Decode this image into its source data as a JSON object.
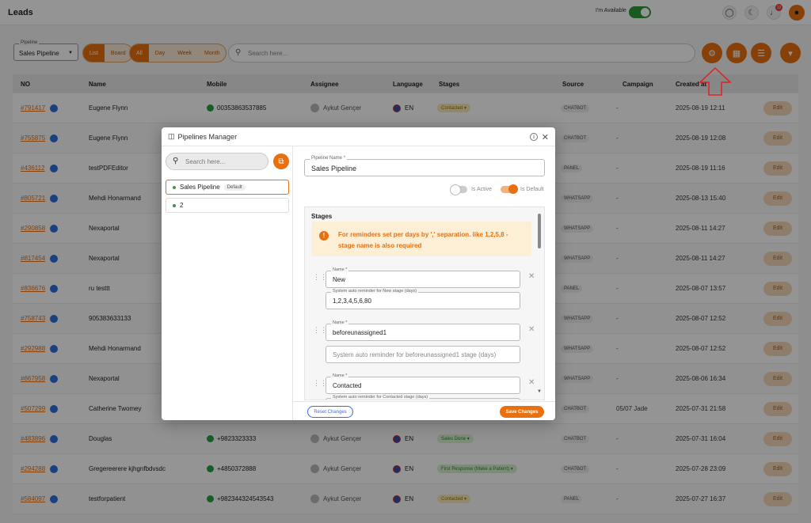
{
  "header": {
    "title": "Leads",
    "availability_label": "I'm Available",
    "notification_count": "12",
    "icons": [
      "globe-icon",
      "moon-icon",
      "bell-icon",
      "user-icon"
    ]
  },
  "filters": {
    "pipeline_label": "Pipeline",
    "pipeline_value": "Sales Pipeline",
    "view_modes": [
      "List",
      "Board"
    ],
    "active_view": "List",
    "periods": [
      "All",
      "Day",
      "Week",
      "Month"
    ],
    "active_period": "All",
    "search_placeholder": "Search here...",
    "action_icons": [
      "gear-icon",
      "board-icon",
      "list-icon",
      "funnel-icon"
    ]
  },
  "table": {
    "columns": [
      "NO",
      "Name",
      "Mobile",
      "Assignee",
      "Language",
      "Stages",
      "Source",
      "Campaign",
      "Created at"
    ],
    "edit_label": "Edit",
    "rows": [
      {
        "id": "#791417",
        "name": "Eugene Flynn",
        "mobile": "00353863537885",
        "assignee": "Aykut Gençer",
        "lang": "EN",
        "stage": "Contacted",
        "source": "CHATBOT",
        "campaign": "-",
        "created": "2025-08-19 12:11"
      },
      {
        "id": "#755875",
        "name": "Eugene Flynn",
        "mobile": "",
        "assignee": "",
        "lang": "",
        "stage": "",
        "source": "CHATBOT",
        "campaign": "-",
        "created": "2025-08-19 12:08"
      },
      {
        "id": "#436112",
        "name": "testPDFEditor",
        "mobile": "",
        "assignee": "",
        "lang": "",
        "stage": "",
        "source": "PANEL",
        "campaign": "-",
        "created": "2025-08-19 11:16"
      },
      {
        "id": "#805721",
        "name": "Mehdi Honarmand",
        "mobile": "",
        "assignee": "",
        "lang": "",
        "stage": "",
        "source": "WHATSAPP",
        "campaign": "-",
        "created": "2025-08-13 15:40"
      },
      {
        "id": "#290858",
        "name": "Nexaportal",
        "mobile": "",
        "assignee": "",
        "lang": "",
        "stage": "",
        "source": "WHATSAPP",
        "campaign": "-",
        "created": "2025-08-11 14:27"
      },
      {
        "id": "#817454",
        "name": "Nexaportal",
        "mobile": "",
        "assignee": "",
        "lang": "",
        "stage": "",
        "source": "WHATSAPP",
        "campaign": "-",
        "created": "2025-08-11 14:27"
      },
      {
        "id": "#836676",
        "name": "ru testtt",
        "mobile": "",
        "assignee": "",
        "lang": "",
        "stage": "",
        "source": "PANEL",
        "campaign": "-",
        "created": "2025-08-07 13:57"
      },
      {
        "id": "#758743",
        "name": "905383633133",
        "mobile": "",
        "assignee": "",
        "lang": "",
        "stage": "",
        "source": "WHATSAPP",
        "campaign": "-",
        "created": "2025-08-07 12:52"
      },
      {
        "id": "#292988",
        "name": "Mehdi Honarmand",
        "mobile": "",
        "assignee": "",
        "lang": "",
        "stage": "",
        "source": "WHATSAPP",
        "campaign": "-",
        "created": "2025-08-07 12:52"
      },
      {
        "id": "#667958",
        "name": "Nexaportal",
        "mobile": "",
        "assignee": "",
        "lang": "",
        "stage": "",
        "source": "WHATSAPP",
        "campaign": "-",
        "created": "2025-08-06 16:34"
      },
      {
        "id": "#507299",
        "name": "Catherine Twomey",
        "mobile": "",
        "assignee": "",
        "lang": "",
        "stage": "",
        "source": "CHATBOT",
        "campaign": "05/07 Jade",
        "created": "2025-07-31 21:58"
      },
      {
        "id": "#483896",
        "name": "Douglas",
        "mobile": "+9823323333",
        "assignee": "Aykut Gençer",
        "lang": "EN",
        "stage": "Sales Done",
        "source": "CHATBOT",
        "campaign": "-",
        "created": "2025-07-31 16:04"
      },
      {
        "id": "#294288",
        "name": "Gregereerere kjhgnfbdvsdc",
        "mobile": "+4850372888",
        "assignee": "Aykut Gençer",
        "lang": "EN",
        "stage": "First Response (Make a Patient)",
        "source": "CHATBOT",
        "campaign": "-",
        "created": "2025-07-28 23:09"
      },
      {
        "id": "#584097",
        "name": "testforpatient",
        "mobile": "+982344324543543",
        "assignee": "Aykut Gençer",
        "lang": "EN",
        "stage": "Contacted",
        "source": "PANEL",
        "campaign": "-",
        "created": "2025-07-27 16:37"
      }
    ]
  },
  "modal": {
    "title": "Pipelines Manager",
    "search_placeholder": "Search here...",
    "pipelines": [
      {
        "name": "Sales Pipeline",
        "badge": "Default"
      },
      {
        "name": "2",
        "badge": ""
      }
    ],
    "pipeline_name_label": "Pipeline Name *",
    "pipeline_name_value": "Sales Pipeline",
    "is_active_label": "Is Active",
    "is_default_label": "Is Default",
    "stages_title": "Stages",
    "warning": "For reminders set per days by ',' separation. like 1,2,5,8 - stage name is also required",
    "stages": [
      {
        "name_label": "Name *",
        "name": "New",
        "reminder_label": "System auto reminder for New stage (days)",
        "reminder": "1,2,3,4,5,6,80",
        "reminder_placeholder": ""
      },
      {
        "name_label": "Name *",
        "name": "beforeunassigned1",
        "reminder_label": "",
        "reminder": "",
        "reminder_placeholder": "System auto reminder for beforeunassigned1 stage (days)"
      },
      {
        "name_label": "Name *",
        "name": "Contacted",
        "reminder_label": "System auto reminder for Contacted stage (days)",
        "reminder": "",
        "reminder_placeholder": ""
      }
    ],
    "reset_label": "Reset Changes",
    "save_label": "Save Changes"
  },
  "colors": {
    "accent": "#e8700f",
    "link": "#3a6fd8",
    "success": "#2e9a3a"
  }
}
